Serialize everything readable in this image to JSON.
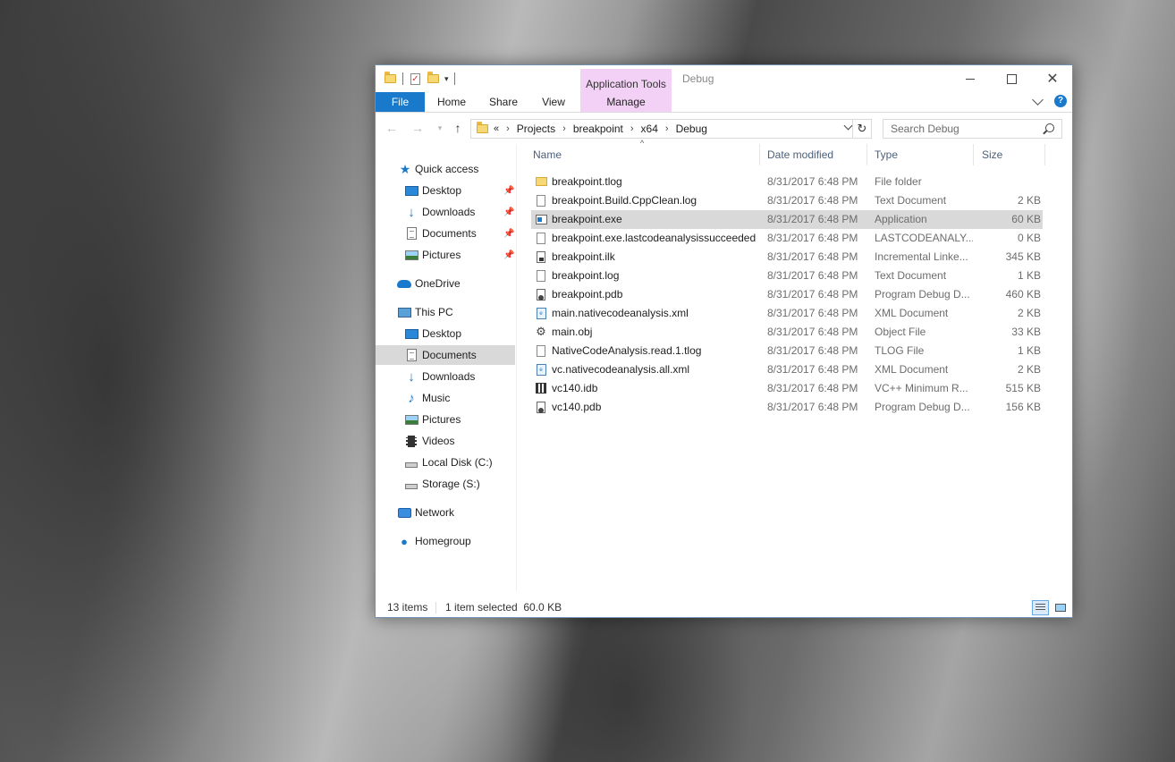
{
  "window": {
    "title": "Debug",
    "context_group": "Application Tools",
    "controls": {
      "minimize": "minimize",
      "maximize": "maximize",
      "close": "✕"
    }
  },
  "ribbon": {
    "tabs": [
      {
        "label": "File"
      },
      {
        "label": "Home"
      },
      {
        "label": "Share"
      },
      {
        "label": "View"
      },
      {
        "label": "Manage"
      }
    ],
    "accent": "#1979ca",
    "context_color": "#f3d0f5"
  },
  "address": {
    "overflow": "«",
    "crumbs": [
      "Projects",
      "breakpoint",
      "x64",
      "Debug"
    ],
    "separator": "›"
  },
  "search": {
    "placeholder": "Search Debug"
  },
  "nav": {
    "items": [
      {
        "label": "Quick access",
        "icon": "star-icon",
        "pinned": false
      },
      {
        "label": "Desktop",
        "icon": "desktop-icon",
        "pinned": true
      },
      {
        "label": "Downloads",
        "icon": "download-icon",
        "pinned": true
      },
      {
        "label": "Documents",
        "icon": "documents-icon",
        "pinned": true
      },
      {
        "label": "Pictures",
        "icon": "pictures-icon",
        "pinned": true
      },
      {
        "label": "OneDrive",
        "icon": "onedrive-icon",
        "pinned": false
      },
      {
        "label": "This PC",
        "icon": "this-pc-icon",
        "pinned": false
      },
      {
        "label": "Desktop",
        "icon": "desktop-icon",
        "pinned": false
      },
      {
        "label": "Documents",
        "icon": "documents-icon",
        "pinned": false,
        "selected": true
      },
      {
        "label": "Downloads",
        "icon": "download-icon",
        "pinned": false
      },
      {
        "label": "Music",
        "icon": "music-icon",
        "pinned": false
      },
      {
        "label": "Pictures",
        "icon": "pictures-icon",
        "pinned": false
      },
      {
        "label": "Videos",
        "icon": "videos-icon",
        "pinned": false
      },
      {
        "label": "Local Disk (C:)",
        "icon": "local-disk-icon",
        "pinned": false
      },
      {
        "label": "Storage (S:)",
        "icon": "drive-icon",
        "pinned": false
      },
      {
        "label": "Network",
        "icon": "network-icon",
        "pinned": false
      },
      {
        "label": "Homegroup",
        "icon": "homegroup-icon",
        "pinned": false
      }
    ]
  },
  "columns": {
    "name": "Name",
    "date": "Date modified",
    "type": "Type",
    "size": "Size"
  },
  "files": [
    {
      "name": "breakpoint.tlog",
      "date": "8/31/2017 6:48 PM",
      "type": "File folder",
      "size": "",
      "icon": "folder-icon"
    },
    {
      "name": "breakpoint.Build.CppClean.log",
      "date": "8/31/2017 6:48 PM",
      "type": "Text Document",
      "size": "2 KB",
      "icon": "text-file-icon"
    },
    {
      "name": "breakpoint.exe",
      "date": "8/31/2017 6:48 PM",
      "type": "Application",
      "size": "60 KB",
      "icon": "exe-icon",
      "selected": true
    },
    {
      "name": "breakpoint.exe.lastcodeanalysissucceeded",
      "date": "8/31/2017 6:48 PM",
      "type": "LASTCODEANALY...",
      "size": "0 KB",
      "icon": "file-icon"
    },
    {
      "name": "breakpoint.ilk",
      "date": "8/31/2017 6:48 PM",
      "type": "Incremental Linke...",
      "size": "345 KB",
      "icon": "ilk-icon"
    },
    {
      "name": "breakpoint.log",
      "date": "8/31/2017 6:48 PM",
      "type": "Text Document",
      "size": "1 KB",
      "icon": "text-file-icon"
    },
    {
      "name": "breakpoint.pdb",
      "date": "8/31/2017 6:48 PM",
      "type": "Program Debug D...",
      "size": "460 KB",
      "icon": "pdb-icon"
    },
    {
      "name": "main.nativecodeanalysis.xml",
      "date": "8/31/2017 6:48 PM",
      "type": "XML Document",
      "size": "2 KB",
      "icon": "xml-icon"
    },
    {
      "name": "main.obj",
      "date": "8/31/2017 6:48 PM",
      "type": "Object File",
      "size": "33 KB",
      "icon": "obj-icon"
    },
    {
      "name": "NativeCodeAnalysis.read.1.tlog",
      "date": "8/31/2017 6:48 PM",
      "type": "TLOG File",
      "size": "1 KB",
      "icon": "file-icon"
    },
    {
      "name": "vc.nativecodeanalysis.all.xml",
      "date": "8/31/2017 6:48 PM",
      "type": "XML Document",
      "size": "2 KB",
      "icon": "xml-icon"
    },
    {
      "name": "vc140.idb",
      "date": "8/31/2017 6:48 PM",
      "type": "VC++ Minimum R...",
      "size": "515 KB",
      "icon": "idb-icon"
    },
    {
      "name": "vc140.pdb",
      "date": "8/31/2017 6:48 PM",
      "type": "Program Debug D...",
      "size": "156 KB",
      "icon": "pdb-icon"
    }
  ],
  "status": {
    "count": "13 items",
    "selection": "1 item selected  60.0 KB"
  }
}
